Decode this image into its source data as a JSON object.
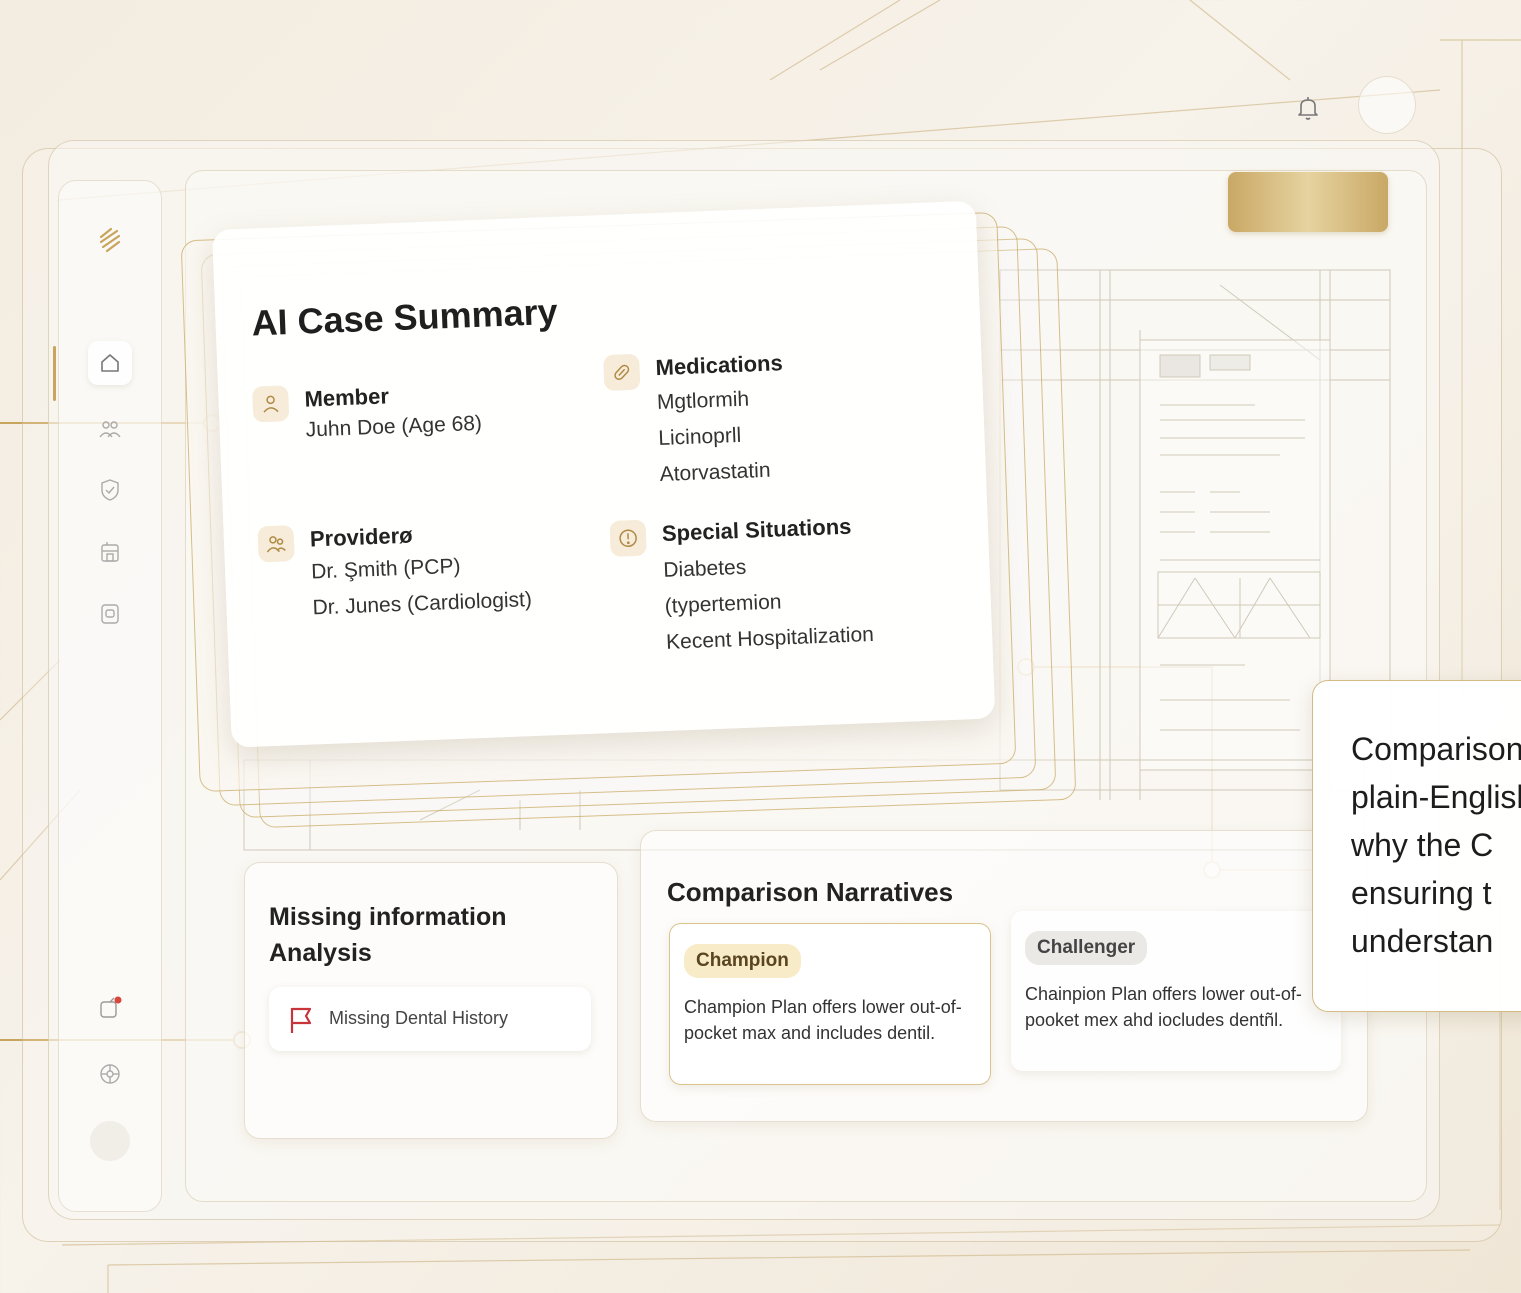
{
  "accent_gold": "#c8a45c",
  "case_summary": {
    "title": "AI Case Summary",
    "member": {
      "heading": "Member",
      "lines": [
        "Juhn Doe (Age 68)"
      ],
      "icon": "person-icon"
    },
    "providers": {
      "heading": "Providerø",
      "lines": [
        "Dr. Şmith (PCP)",
        "Dr. Junes (Cardiologist)"
      ],
      "icon": "people-icon"
    },
    "medications": {
      "heading": "Medications",
      "lines": [
        "Mgtlormih",
        "Licinoprll",
        "Atorvastatin"
      ],
      "icon": "pill-icon"
    },
    "special": {
      "heading": "Special Situations",
      "lines": [
        "Diabetes",
        "(typertemion",
        "Kecent Hospitalization"
      ],
      "icon": "alert-circle-icon"
    }
  },
  "missing": {
    "title": "Missing information Analysis",
    "item": "Missing Dental History"
  },
  "comparison": {
    "title": "Comparison Narratives",
    "champion": {
      "tag": "Champion",
      "text": "Champion Plan offers lower out-of-pocket max and includes dentil."
    },
    "challenger": {
      "tag": "Challenger",
      "text": "Chainpion Plan offers lower out-of-pooket mex ahd iocludes dentñl."
    }
  },
  "callout": {
    "text": "Comparison\nplain-English\nwhy the C\nensuring t\nunderstan"
  },
  "sidebar_icons": [
    "logo-icon",
    "home-icon",
    "users-icon",
    "shield-icon",
    "building-icon",
    "document-icon",
    "notification-icon",
    "settings-icon"
  ]
}
